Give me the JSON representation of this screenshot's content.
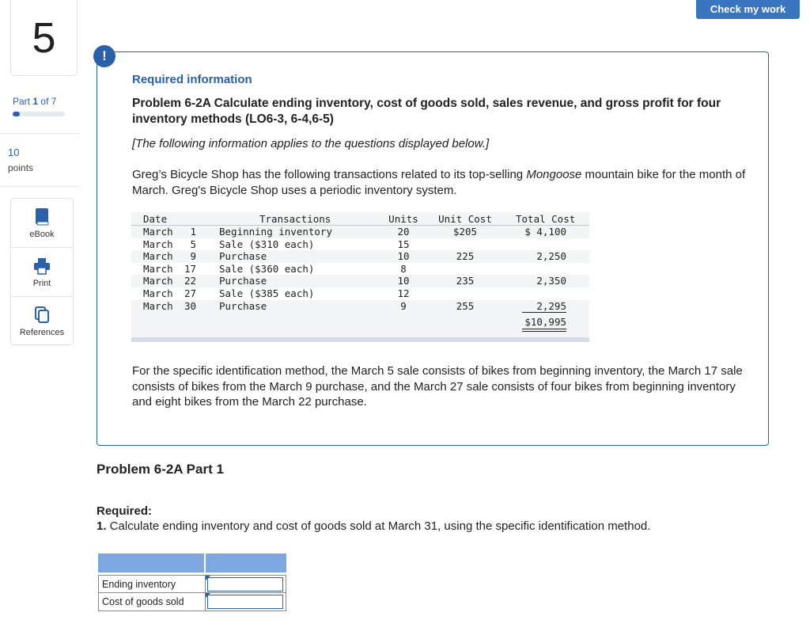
{
  "header": {
    "check_label": "Check my work"
  },
  "rail": {
    "question_number": "5",
    "part_word": "Part",
    "part_current": "1",
    "part_of": "of 7",
    "progress_fraction": 0.14,
    "points_value": "10",
    "points_label": "points",
    "tools": [
      {
        "label": "eBook",
        "icon": "book-icon"
      },
      {
        "label": "Print",
        "icon": "printer-icon"
      },
      {
        "label": "References",
        "icon": "references-icon"
      }
    ]
  },
  "info": {
    "alert": "!",
    "required_info": "Required information",
    "problem_title": "Problem 6-2A Calculate ending inventory, cost of goods sold, sales revenue, and gross profit for four inventory methods (LO6-3, 6-4,6-5)",
    "applies": "[The following information applies to the questions displayed below.]",
    "intro_pre": "Greg’s Bicycle Shop has the following transactions related to its top-selling ",
    "intro_italic": "Mongoose",
    "intro_post": " mountain bike for the month of March. Greg's Bicycle Shop uses a periodic inventory system.",
    "table": {
      "headers": {
        "date": "Date",
        "transactions": "Transactions",
        "units": "Units",
        "unit_cost": "Unit Cost",
        "total_cost": "Total Cost"
      },
      "rows": [
        {
          "month": "March",
          "day": "1",
          "transaction": "Beginning inventory",
          "units": "20",
          "unit_cost": "$205",
          "total_cost": "$ 4,100"
        },
        {
          "month": "March",
          "day": "5",
          "transaction": "Sale ($310 each)",
          "units": "15",
          "unit_cost": "",
          "total_cost": ""
        },
        {
          "month": "March",
          "day": "9",
          "transaction": "Purchase",
          "units": "10",
          "unit_cost": "225",
          "total_cost": "2,250"
        },
        {
          "month": "March",
          "day": "17",
          "transaction": "Sale ($360 each)",
          "units": "8",
          "unit_cost": "",
          "total_cost": ""
        },
        {
          "month": "March",
          "day": "22",
          "transaction": "Purchase",
          "units": "10",
          "unit_cost": "235",
          "total_cost": "2,350"
        },
        {
          "month": "March",
          "day": "27",
          "transaction": "Sale ($385 each)",
          "units": "12",
          "unit_cost": "",
          "total_cost": ""
        },
        {
          "month": "March",
          "day": "30",
          "transaction": "Purchase",
          "units": "9",
          "unit_cost": "255",
          "total_cost": "2,295"
        }
      ],
      "total": "$10,995"
    },
    "specific": "For the specific identification method, the March 5 sale consists of bikes from beginning inventory, the March 17 sale consists of bikes from the March 9 purchase, and the March 27 sale consists of four bikes from beginning inventory and eight bikes from the March 22 purchase."
  },
  "part": {
    "title": "Problem 6-2A Part 1",
    "required_label": "Required:",
    "required_num": "1.",
    "required_text": " Calculate ending inventory and cost of goods sold at March 31, using the specific identification method."
  },
  "answer": {
    "rows": [
      {
        "label": "Ending inventory",
        "value": ""
      },
      {
        "label": "Cost of goods sold",
        "value": ""
      }
    ]
  }
}
